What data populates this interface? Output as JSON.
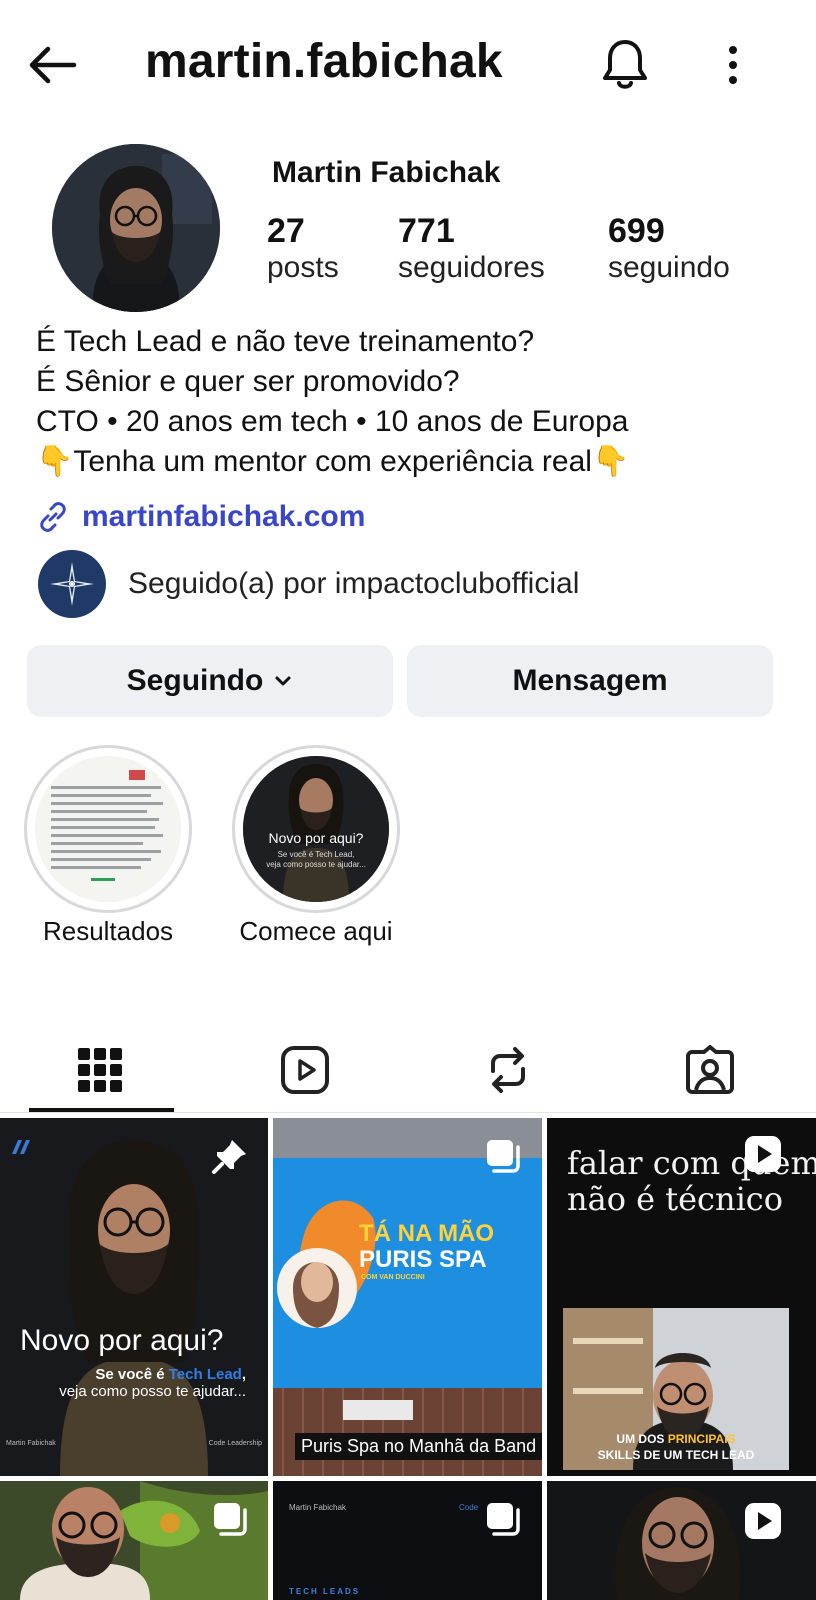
{
  "header": {
    "username": "martin.fabichak",
    "back_icon": "arrow-left-icon",
    "bell_icon": "bell-icon",
    "more_icon": "more-vertical-icon"
  },
  "profile": {
    "full_name": "Martin Fabichak",
    "stats": [
      {
        "value": "27",
        "label": "posts"
      },
      {
        "value": "771",
        "label": "seguidores"
      },
      {
        "value": "699",
        "label": "seguindo"
      }
    ],
    "bio": [
      "É Tech Lead e não teve treinamento?",
      "É Sênior e quer ser promovido?",
      "CTO • 20 anos em tech • 10 anos de Europa",
      "👇Tenha um mentor com experiência real👇"
    ],
    "link": "martinfabichak.com",
    "followed_by": "Seguido(a) por impactoclubofficial"
  },
  "actions": {
    "following_label": "Seguindo",
    "message_label": "Mensagem"
  },
  "highlights": [
    {
      "label": "Resultados"
    },
    {
      "label": "Comece aqui",
      "cover_title": "Novo por aqui?",
      "cover_sub_1": "Se você é Tech Lead,",
      "cover_sub_2": "veja como posso te ajudar..."
    }
  ],
  "tabs": [
    "grid-icon",
    "reels-icon",
    "reposts-icon",
    "tagged-icon"
  ],
  "posts": [
    {
      "title": "Novo por aqui?",
      "sub_prefix": "Se você é ",
      "sub_highlight": "Tech Lead",
      "sub_suffix": ",",
      "sub_2": "veja como posso te ajudar...",
      "footer_left": "Martin Fabichak",
      "footer_right": "Code Leadership",
      "indicator": "pin-icon"
    },
    {
      "tv_line_1": "TÁ NA MÃO",
      "tv_line_2": "PURIS SPA",
      "tv_line_3": "COM VAN DUCCINI",
      "caption": "Puris Spa no Manhã da Band",
      "indicator": "carousel-icon"
    },
    {
      "line_1": "falar com quem",
      "line_2": "não é técnico",
      "cap_1_prefix": "UM DOS ",
      "cap_1_highlight": "PRINCIPAIS",
      "cap_2": "SKILLS DE UM TECH LEAD",
      "indicator": "reel-icon"
    },
    {
      "indicator": "carousel-icon"
    },
    {
      "header_left": "Martin Fabichak",
      "header_right": "Code",
      "footer": "TECH LEADS",
      "indicator": "carousel-icon"
    },
    {
      "indicator": "reel-icon"
    }
  ],
  "colors": {
    "link": "#3946c9",
    "button_bg": "#eef0f4",
    "tech_lead_blue": "#2f7fe8"
  }
}
